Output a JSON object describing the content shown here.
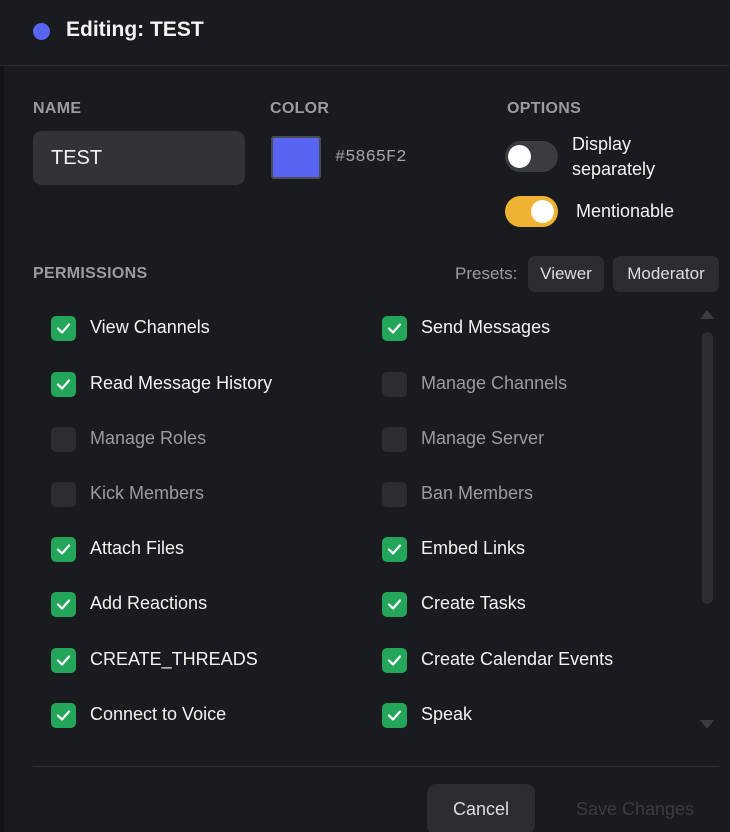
{
  "header": {
    "title": "Editing: TEST",
    "dot_color": "#5865F2"
  },
  "form": {
    "name_label": "NAME",
    "name_value": "TEST",
    "color_label": "COLOR",
    "color_value": "#5865F2",
    "options_label": "OPTIONS",
    "option_display_separately": "Display separately",
    "option_display_separately_on": false,
    "option_mentionable": "Mentionable",
    "option_mentionable_on": true
  },
  "permissions": {
    "label": "PERMISSIONS",
    "presets_label": "Presets:",
    "preset_viewer": "Viewer",
    "preset_moderator": "Moderator",
    "items": [
      {
        "label": "View Channels",
        "checked": true
      },
      {
        "label": "Send Messages",
        "checked": true
      },
      {
        "label": "Read Message History",
        "checked": true
      },
      {
        "label": "Manage Channels",
        "checked": false
      },
      {
        "label": "Manage Roles",
        "checked": false
      },
      {
        "label": "Manage Server",
        "checked": false
      },
      {
        "label": "Kick Members",
        "checked": false
      },
      {
        "label": "Ban Members",
        "checked": false
      },
      {
        "label": "Attach Files",
        "checked": true
      },
      {
        "label": "Embed Links",
        "checked": true
      },
      {
        "label": "Add Reactions",
        "checked": true
      },
      {
        "label": "Create Tasks",
        "checked": true
      },
      {
        "label": "CREATE_THREADS",
        "checked": true
      },
      {
        "label": "Create Calendar Events",
        "checked": true
      },
      {
        "label": "Connect to Voice",
        "checked": true
      },
      {
        "label": "Speak",
        "checked": true
      }
    ]
  },
  "footer": {
    "cancel_label": "Cancel",
    "save_label": "Save Changes"
  },
  "colors": {
    "background": "#1a1b1e",
    "accent": "#5865F2",
    "check_green": "#23a55a",
    "toggle_on": "#f0b232"
  }
}
